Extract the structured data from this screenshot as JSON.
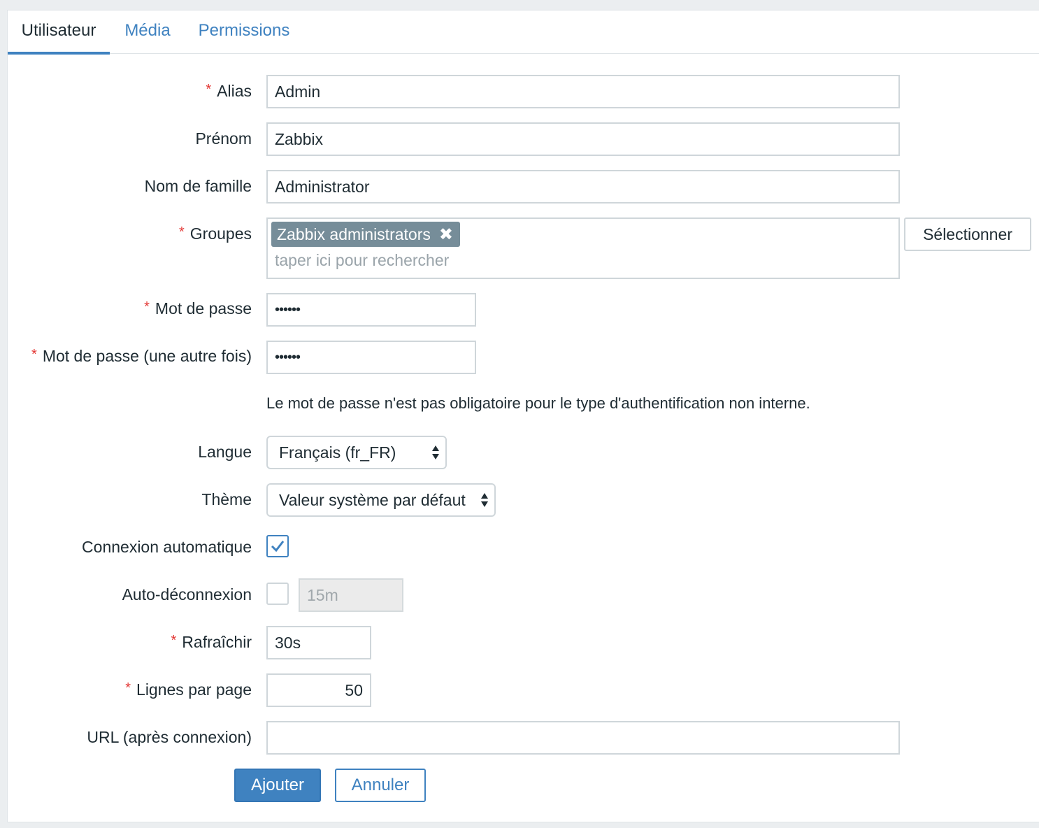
{
  "tabs": [
    {
      "label": "Utilisateur",
      "active": true
    },
    {
      "label": "Média",
      "active": false
    },
    {
      "label": "Permissions",
      "active": false
    }
  ],
  "form": {
    "alias": {
      "label": "Alias",
      "required": true,
      "value": "Admin"
    },
    "prenom": {
      "label": "Prénom",
      "required": false,
      "value": "Zabbix"
    },
    "nom": {
      "label": "Nom de famille",
      "required": false,
      "value": "Administrator"
    },
    "groupes": {
      "label": "Groupes",
      "required": true,
      "chips": [
        "Zabbix administrators"
      ],
      "placeholder": "taper ici pour rechercher",
      "select_button": "Sélectionner"
    },
    "password": {
      "label": "Mot de passe",
      "required": true,
      "value": "••••••"
    },
    "password2": {
      "label": "Mot de passe (une autre fois)",
      "required": true,
      "value": "••••••"
    },
    "password_hint": "Le mot de passe n'est pas obligatoire pour le type d'authentification non interne.",
    "langue": {
      "label": "Langue",
      "value": "Français (fr_FR)"
    },
    "theme": {
      "label": "Thème",
      "value": "Valeur système par défaut"
    },
    "autologin": {
      "label": "Connexion automatique",
      "checked": true
    },
    "autologout": {
      "label": "Auto-déconnexion",
      "checked": false,
      "value": "15m"
    },
    "refresh": {
      "label": "Rafraîchir",
      "required": true,
      "value": "30s"
    },
    "rows_per_page": {
      "label": "Lignes par page",
      "required": true,
      "value": "50"
    },
    "url": {
      "label": "URL (après connexion)",
      "value": ""
    }
  },
  "buttons": {
    "add": "Ajouter",
    "cancel": "Annuler"
  },
  "colors": {
    "accent": "#3f82c0",
    "required": "#e33734",
    "chip": "#768d99"
  }
}
